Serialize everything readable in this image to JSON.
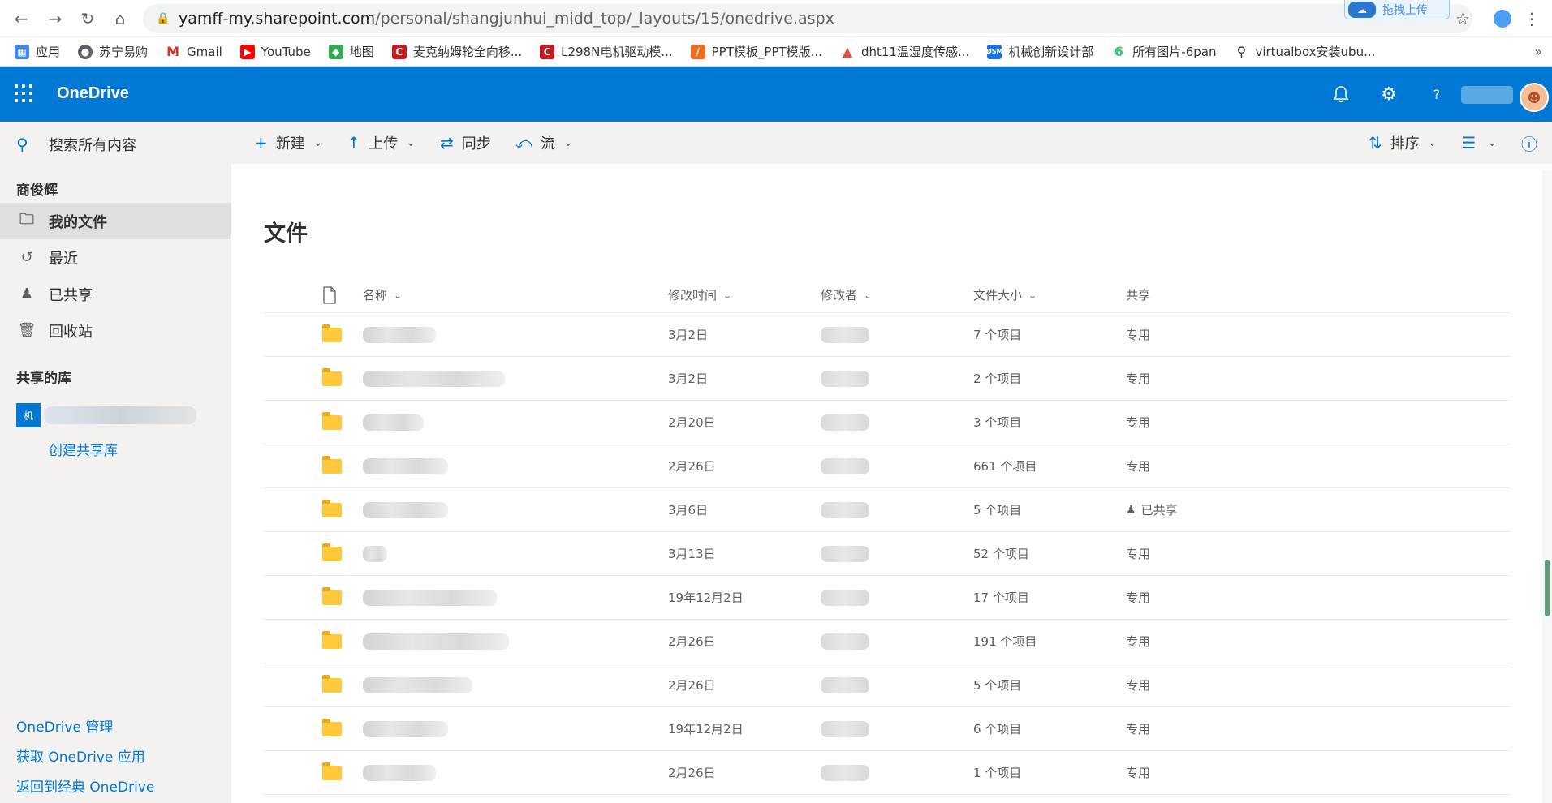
{
  "browser": {
    "url_host": "yamff-my.sharepoint.com",
    "url_path": "/personal/shangjunhui_midd_top/_layouts/15/onedrive.aspx",
    "float_label": "拖拽上传"
  },
  "bookmarks": [
    {
      "label": "应用",
      "icon": "apps-icon",
      "color": "#4285f4"
    },
    {
      "label": "苏宁易购",
      "icon": "globe-icon",
      "color": "#5f6368"
    },
    {
      "label": "Gmail",
      "icon": "gmail-icon",
      "color": "#d93025"
    },
    {
      "label": "YouTube",
      "icon": "youtube-icon",
      "color": "#ff0000"
    },
    {
      "label": "地图",
      "icon": "maps-icon",
      "color": "#34a853"
    },
    {
      "label": "麦克纳姆轮全向移...",
      "icon": "csdn-icon",
      "color": "#c9191e"
    },
    {
      "label": "L298N电机驱动模...",
      "icon": "csdn-icon",
      "color": "#c9191e"
    },
    {
      "label": "PPT模板_PPT模版...",
      "icon": "ppt-icon",
      "color": "#f26b21"
    },
    {
      "label": "dht11温湿度传感...",
      "icon": "flame-icon",
      "color": "#e74c3c"
    },
    {
      "label": "机械创新设计部",
      "icon": "dsm-icon",
      "color": "#1a73e8"
    },
    {
      "label": "所有图片-6pan",
      "icon": "six-icon",
      "color": "#2ecc71"
    },
    {
      "label": "virtualbox安装ubu...",
      "icon": "github-icon",
      "color": "#333333"
    }
  ],
  "suite": {
    "brand": "OneDrive"
  },
  "leftnav": {
    "search_placeholder": "搜索所有内容",
    "user_group": "商俊辉",
    "items": [
      {
        "label": "我的文件",
        "icon": "folder-outline-icon",
        "active": true
      },
      {
        "label": "最近",
        "icon": "history-icon",
        "active": false
      },
      {
        "label": "已共享",
        "icon": "people-icon",
        "active": false
      },
      {
        "label": "回收站",
        "icon": "recycle-bin-icon",
        "active": false
      }
    ],
    "shared_libs_title": "共享的库",
    "lib_badge": "机",
    "create_lib": "创建共享库",
    "bottom_links": [
      "OneDrive 管理",
      "获取 OneDrive 应用",
      "返回到经典 OneDrive"
    ]
  },
  "cmdbar": {
    "new": "新建",
    "upload": "上传",
    "sync": "同步",
    "flow": "流",
    "sort": "排序"
  },
  "main": {
    "title": "文件",
    "columns": {
      "name": "名称",
      "modified": "修改时间",
      "modified_by": "修改者",
      "size": "文件大小",
      "sharing": "共享"
    },
    "rows": [
      {
        "modified": "3月2日",
        "size": "7 个项目",
        "sharing": "专用",
        "shared": false
      },
      {
        "modified": "3月2日",
        "size": "2 个项目",
        "sharing": "专用",
        "shared": false
      },
      {
        "modified": "2月20日",
        "size": "3 个项目",
        "sharing": "专用",
        "shared": false
      },
      {
        "modified": "2月26日",
        "size": "661 个项目",
        "sharing": "专用",
        "shared": false
      },
      {
        "modified": "3月6日",
        "size": "5 个项目",
        "sharing": "已共享",
        "shared": true
      },
      {
        "modified": "3月13日",
        "size": "52 个项目",
        "sharing": "专用",
        "shared": false
      },
      {
        "modified": "19年12月2日",
        "size": "17 个项目",
        "sharing": "专用",
        "shared": false
      },
      {
        "modified": "2月26日",
        "size": "191 个项目",
        "sharing": "专用",
        "shared": false
      },
      {
        "modified": "2月26日",
        "size": "5 个项目",
        "sharing": "专用",
        "shared": false
      },
      {
        "modified": "19年12月2日",
        "size": "6 个项目",
        "sharing": "专用",
        "shared": false
      },
      {
        "modified": "2月26日",
        "size": "1 个项目",
        "sharing": "专用",
        "shared": false
      }
    ]
  },
  "colors": {
    "brand": "#0078d4",
    "nav_bg": "#f3f2f1",
    "folder": "#ffc93c"
  }
}
